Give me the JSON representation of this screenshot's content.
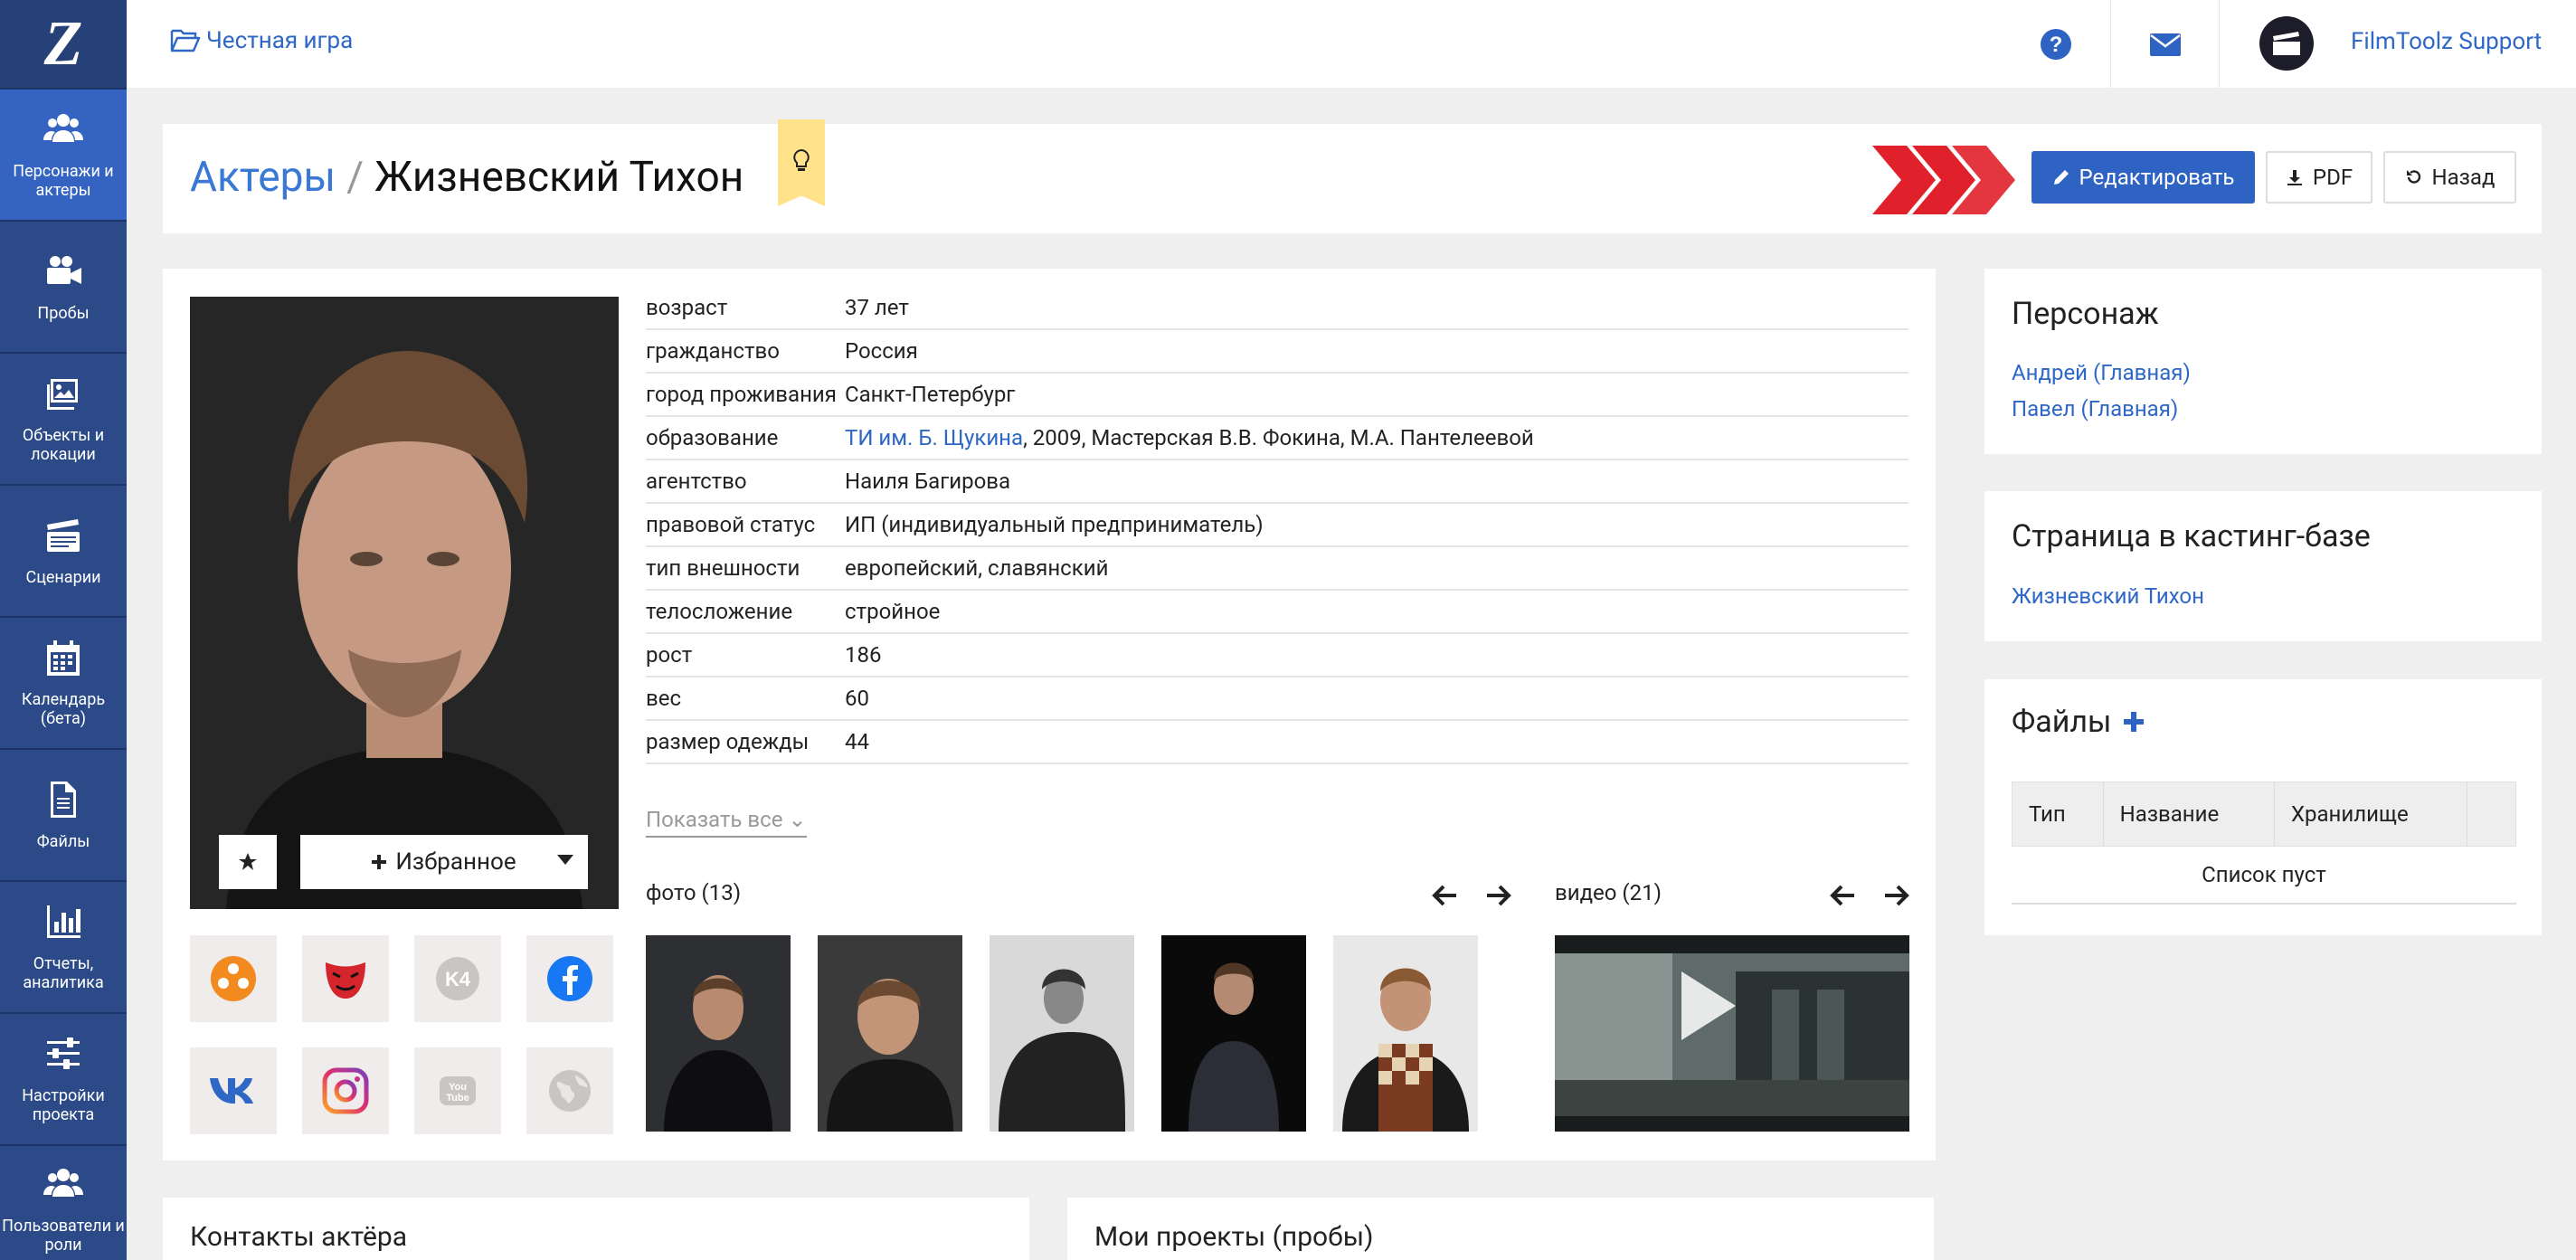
{
  "sidebar": {
    "logo": "Z",
    "items": [
      {
        "label": "Персонажи и актеры",
        "icon": "users-icon",
        "active": true
      },
      {
        "label": "Пробы",
        "icon": "video-camera-icon"
      },
      {
        "label": "Объекты и локации",
        "icon": "image-icon"
      },
      {
        "label": "Сценарии",
        "icon": "clapperboard-icon"
      },
      {
        "label": "Календарь (бета)",
        "icon": "calendar-icon"
      },
      {
        "label": "Файлы",
        "icon": "file-icon"
      },
      {
        "label": "Отчеты, аналитика",
        "icon": "bar-chart-icon"
      },
      {
        "label": "Настройки проекта",
        "icon": "sliders-icon"
      },
      {
        "label": "Пользователи и роли",
        "icon": "users-icon"
      }
    ]
  },
  "topbar": {
    "project": "Честная игра",
    "user_name": "FilmToolz Support"
  },
  "header": {
    "breadcrumb_parent": "Актеры",
    "breadcrumb_sep": "/",
    "title": "Жизневский Тихон",
    "edit_label": "Редактировать",
    "pdf_label": "PDF",
    "back_label": "Назад"
  },
  "profile": {
    "favorite_label": "Избранное",
    "fields": [
      {
        "key": "возраст",
        "value": "37 лет"
      },
      {
        "key": "гражданство",
        "value": "Россия"
      },
      {
        "key": "город проживания",
        "value": "Санкт-Петербург"
      },
      {
        "key": "образование",
        "link": "ТИ им. Б. Щукина",
        "value": ", 2009, Мастерская В.В. Фокина, М.А. Пантелеевой"
      },
      {
        "key": "агентство",
        "link": "Наиля Багирова",
        "value": ""
      },
      {
        "key": "правовой статус",
        "value": "ИП (индивидуальный предприниматель)"
      },
      {
        "key": "тип внешности",
        "value": "европейский, славянский"
      },
      {
        "key": "телосложение",
        "value": "стройное"
      },
      {
        "key": "рост",
        "value": "186"
      },
      {
        "key": "вес",
        "value": "60"
      },
      {
        "key": "размер одежды",
        "value": "44"
      }
    ],
    "show_all": "Показать все",
    "photos_label": "фото (13)",
    "videos_label": "видео (21)",
    "socials": [
      "kinopoisk-icon",
      "theatre-mask-icon",
      "kinoteatr-icon",
      "facebook-icon",
      "vk-icon",
      "instagram-icon",
      "youtube-icon",
      "globe-icon"
    ]
  },
  "character_card": {
    "title": "Персонаж",
    "links": [
      "Андрей (Главная)",
      "Павел (Главная)"
    ]
  },
  "casting_card": {
    "title": "Страница в кастинг-базе",
    "link": "Жизневский Тихон"
  },
  "files_card": {
    "title": "Файлы",
    "columns": [
      "Тип",
      "Название",
      "Хранилище",
      ""
    ],
    "empty": "Список пуст"
  },
  "bottom": {
    "contacts_title": "Контакты актёра",
    "projects_title": "Мои проекты (пробы)"
  },
  "colors": {
    "sidebar": "#2b4a87",
    "sidebar_active": "#3563c2",
    "accent": "#2e67c6",
    "primary_button": "#2e63c4",
    "chevrons": "#e0202a",
    "bulb_tag": "#ffe28a"
  }
}
